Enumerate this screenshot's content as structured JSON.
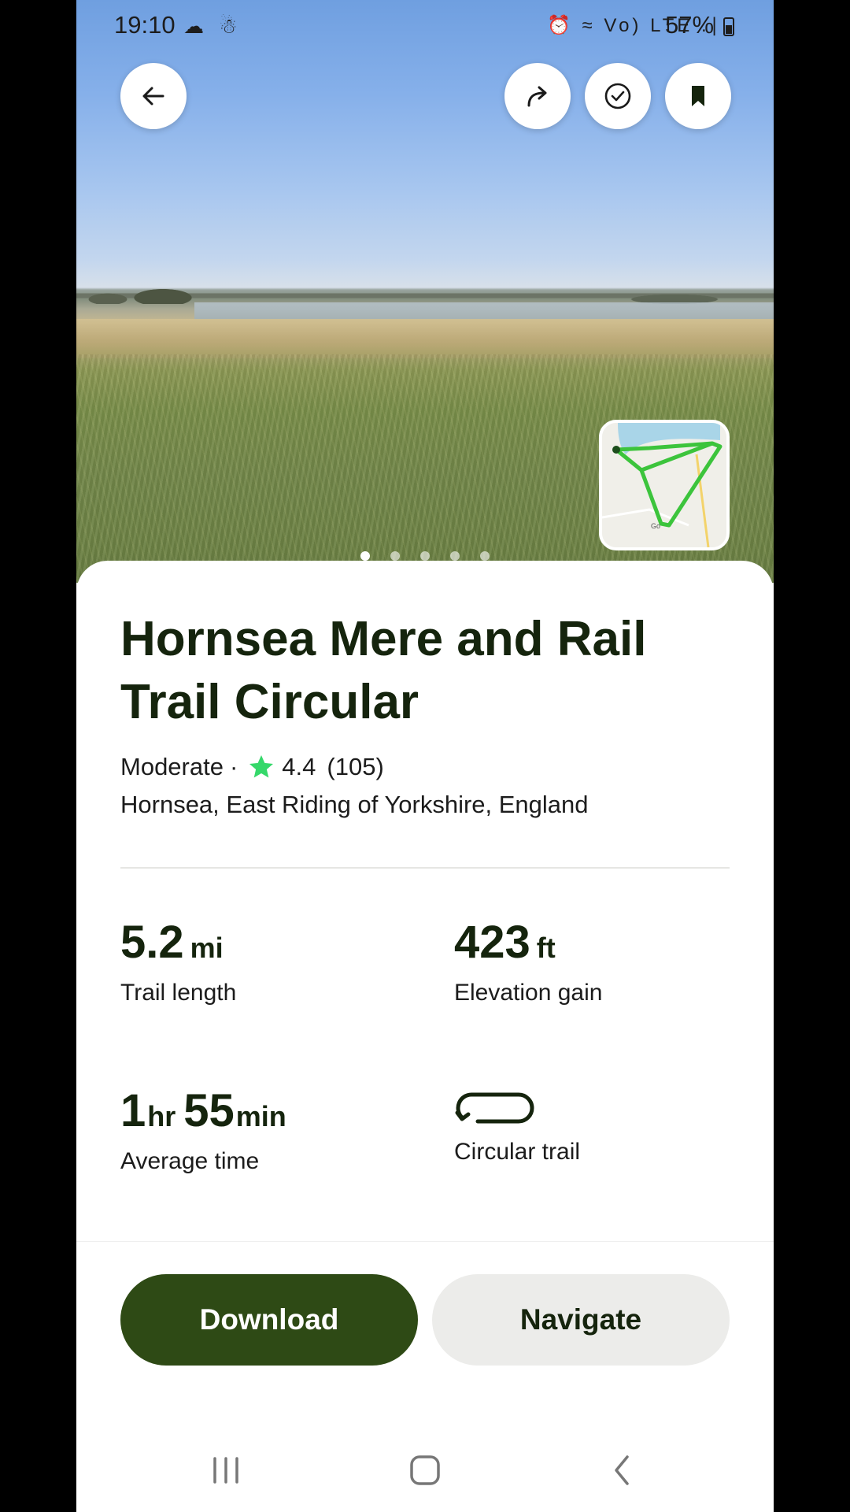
{
  "status_bar": {
    "time": "19:10",
    "left_icons": "☁ ☃",
    "right_icons": "⏰ ≈ Vo) LTE .∣",
    "battery": "57%"
  },
  "hero": {
    "back_icon": "arrow-left-icon",
    "share_icon": "share-arrow-icon",
    "completed_icon": "check-circle-icon",
    "save_icon": "bookmark-icon",
    "map_label": "Go",
    "pager_total": 5,
    "pager_active": 0
  },
  "trail": {
    "title": "Hornsea Mere and Rail Trail Circular",
    "difficulty": "Moderate",
    "separator": "·",
    "rating": "4.4",
    "rating_count": "(105)",
    "location": "Hornsea, East Riding of Yorkshire, England"
  },
  "stats": {
    "length_value": "5.2",
    "length_unit": "mi",
    "length_label": "Trail length",
    "elevation_value": "423",
    "elevation_unit": "ft",
    "elevation_label": "Elevation gain",
    "time_hours": "1",
    "time_hours_unit": "hr",
    "time_minutes": "55",
    "time_minutes_unit": "min",
    "time_label": "Average time",
    "route_type_label": "Circular trail"
  },
  "actions": {
    "download_label": "Download",
    "navigate_label": "Navigate"
  },
  "colors": {
    "primary_green": "#2e4a15",
    "title_text": "#15240d",
    "star": "#35d86a",
    "route": "#3cc43c"
  }
}
